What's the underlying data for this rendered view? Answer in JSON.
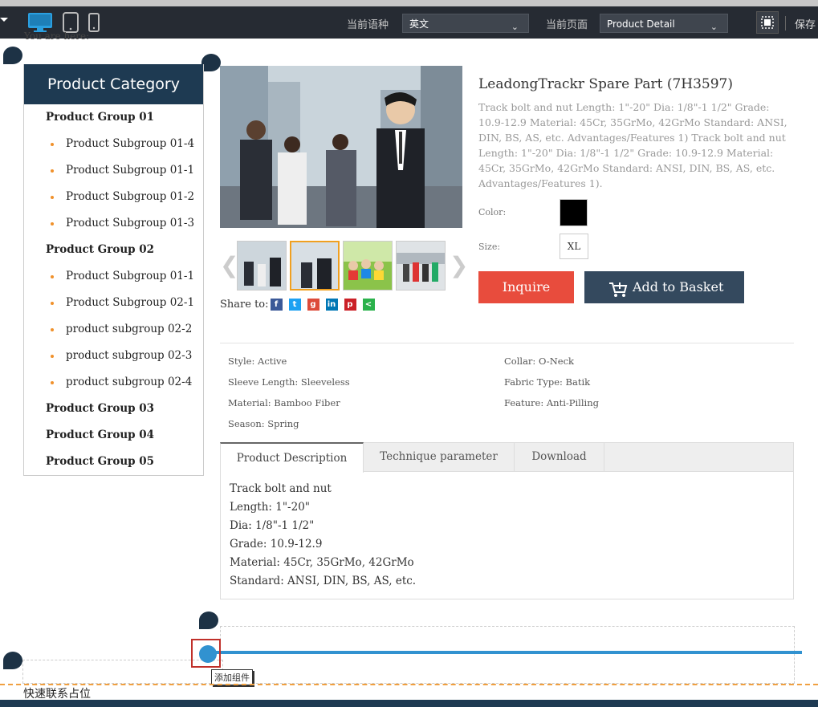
{
  "toolbar": {
    "language_label": "当前语种",
    "language_value": "英文",
    "page_label": "当前页面",
    "page_value": "Product Detail",
    "save_label": "保存"
  },
  "breadcrumb": {
    "text": "You are here:"
  },
  "sidebar": {
    "title": "Product Category",
    "items": [
      {
        "label": "Product Group 01",
        "type": "group"
      },
      {
        "label": "Product Subgroup 01-4",
        "type": "sub"
      },
      {
        "label": "Product Subgroup 01-1",
        "type": "sub"
      },
      {
        "label": "Product Subgroup 01-2",
        "type": "sub"
      },
      {
        "label": "Product Subgroup 01-3",
        "type": "sub"
      },
      {
        "label": "Product Group 02",
        "type": "group"
      },
      {
        "label": "Product Subgroup 01-1",
        "type": "sub"
      },
      {
        "label": "Product Subgroup 02-1",
        "type": "sub"
      },
      {
        "label": "product subgroup 02-2",
        "type": "sub"
      },
      {
        "label": "product subgroup 02-3",
        "type": "sub"
      },
      {
        "label": "product subgroup 02-4",
        "type": "sub"
      },
      {
        "label": "Product Group 03",
        "type": "group"
      },
      {
        "label": "Product Group 04",
        "type": "group"
      },
      {
        "label": "Product Group 05",
        "type": "group"
      }
    ]
  },
  "product": {
    "title": "LeadongTrackr Spare Part (7H3597)",
    "description": "Track bolt and nut Length: 1\"-20\" Dia: 1/8\"-1 1/2\" Grade: 10.9-12.9 Material: 45Cr, 35GrMo, 42GrMo Standard: ANSI, DIN, BS, AS, etc. Advantages/Features 1) Track bolt and nut Length: 1\"-20\" Dia: 1/8\"-1 1/2\" Grade: 10.9-12.9 Material: 45Cr, 35GrMo, 42GrMo Standard: ANSI, DIN, BS, AS, etc. Advantages/Features 1).",
    "color_label": "Color:",
    "color_value": "#000000",
    "size_label": "Size:",
    "size_value": "XL",
    "inquire_label": "Inquire",
    "basket_label": "Add to Basket",
    "share_label": "Share to:"
  },
  "attributes": {
    "style": "Style: Active",
    "collar": "Collar: O-Neck",
    "sleeve": "Sleeve Length: Sleeveless",
    "fabric": "Fabric Type: Batik",
    "material": "Material: Bamboo Fiber",
    "feature": "Feature: Anti-Pilling",
    "season": "Season: Spring"
  },
  "tabs": {
    "items": [
      "Product Description",
      "Technique parameter",
      "Download"
    ],
    "active": 0
  },
  "description_lines": [
    "Track bolt and nut",
    "Length: 1\"-20\"",
    "Dia: 1/8\"-1 1/2\"",
    "Grade: 10.9-12.9",
    "Material: 45Cr, 35GrMo, 42GrMo",
    "Standard: ANSI, DIN, BS, AS, etc."
  ],
  "editor": {
    "add_component_tooltip": "添加组件",
    "quick_contact_placeholder": "快速联系占位"
  },
  "colors": {
    "sidebar_header": "#1e3a52",
    "inquire": "#e84c3d",
    "basket": "#34495e",
    "accent_blue": "#3192d0",
    "bullet": "#f0912b"
  }
}
